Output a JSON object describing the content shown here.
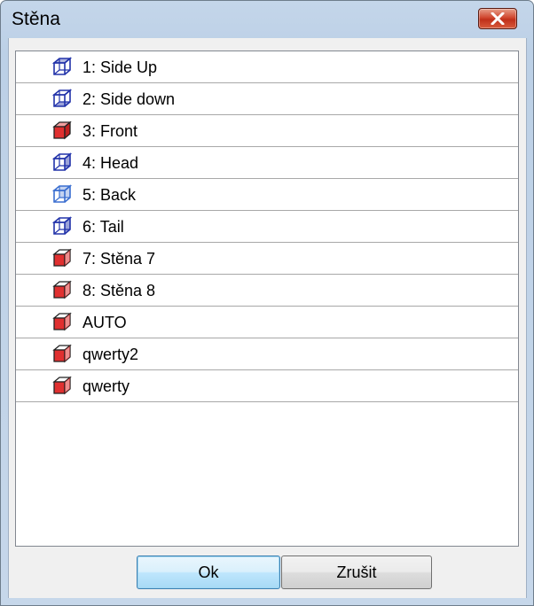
{
  "window": {
    "title": "Stěna",
    "close_icon": "close-x"
  },
  "list": {
    "items": [
      {
        "label": "1: Side Up",
        "icon": "box-wire-top-icon",
        "color": "#2233aa"
      },
      {
        "label": "2: Side down",
        "icon": "box-wire-bottom-icon",
        "color": "#2233aa"
      },
      {
        "label": "3: Front",
        "icon": "box-front-red-icon",
        "color": "#e03030"
      },
      {
        "label": "4: Head",
        "icon": "box-wire-side-icon",
        "color": "#2233aa"
      },
      {
        "label": "5: Back",
        "icon": "box-wire-back-icon",
        "color": "#3a6ed0"
      },
      {
        "label": "6: Tail",
        "icon": "box-wire-side-icon",
        "color": "#2233aa"
      },
      {
        "label": "7: Stěna 7",
        "icon": "box-red-icon",
        "color": "#e03030"
      },
      {
        "label": "8: Stěna 8",
        "icon": "box-red-icon",
        "color": "#e03030"
      },
      {
        "label": "AUTO",
        "icon": "box-red-icon",
        "color": "#e03030"
      },
      {
        "label": "qwerty2",
        "icon": "box-red-icon",
        "color": "#e03030"
      },
      {
        "label": "qwerty",
        "icon": "box-red-icon",
        "color": "#e03030"
      }
    ]
  },
  "buttons": {
    "ok_label": "Ok",
    "cancel_label": "Zrušit"
  }
}
